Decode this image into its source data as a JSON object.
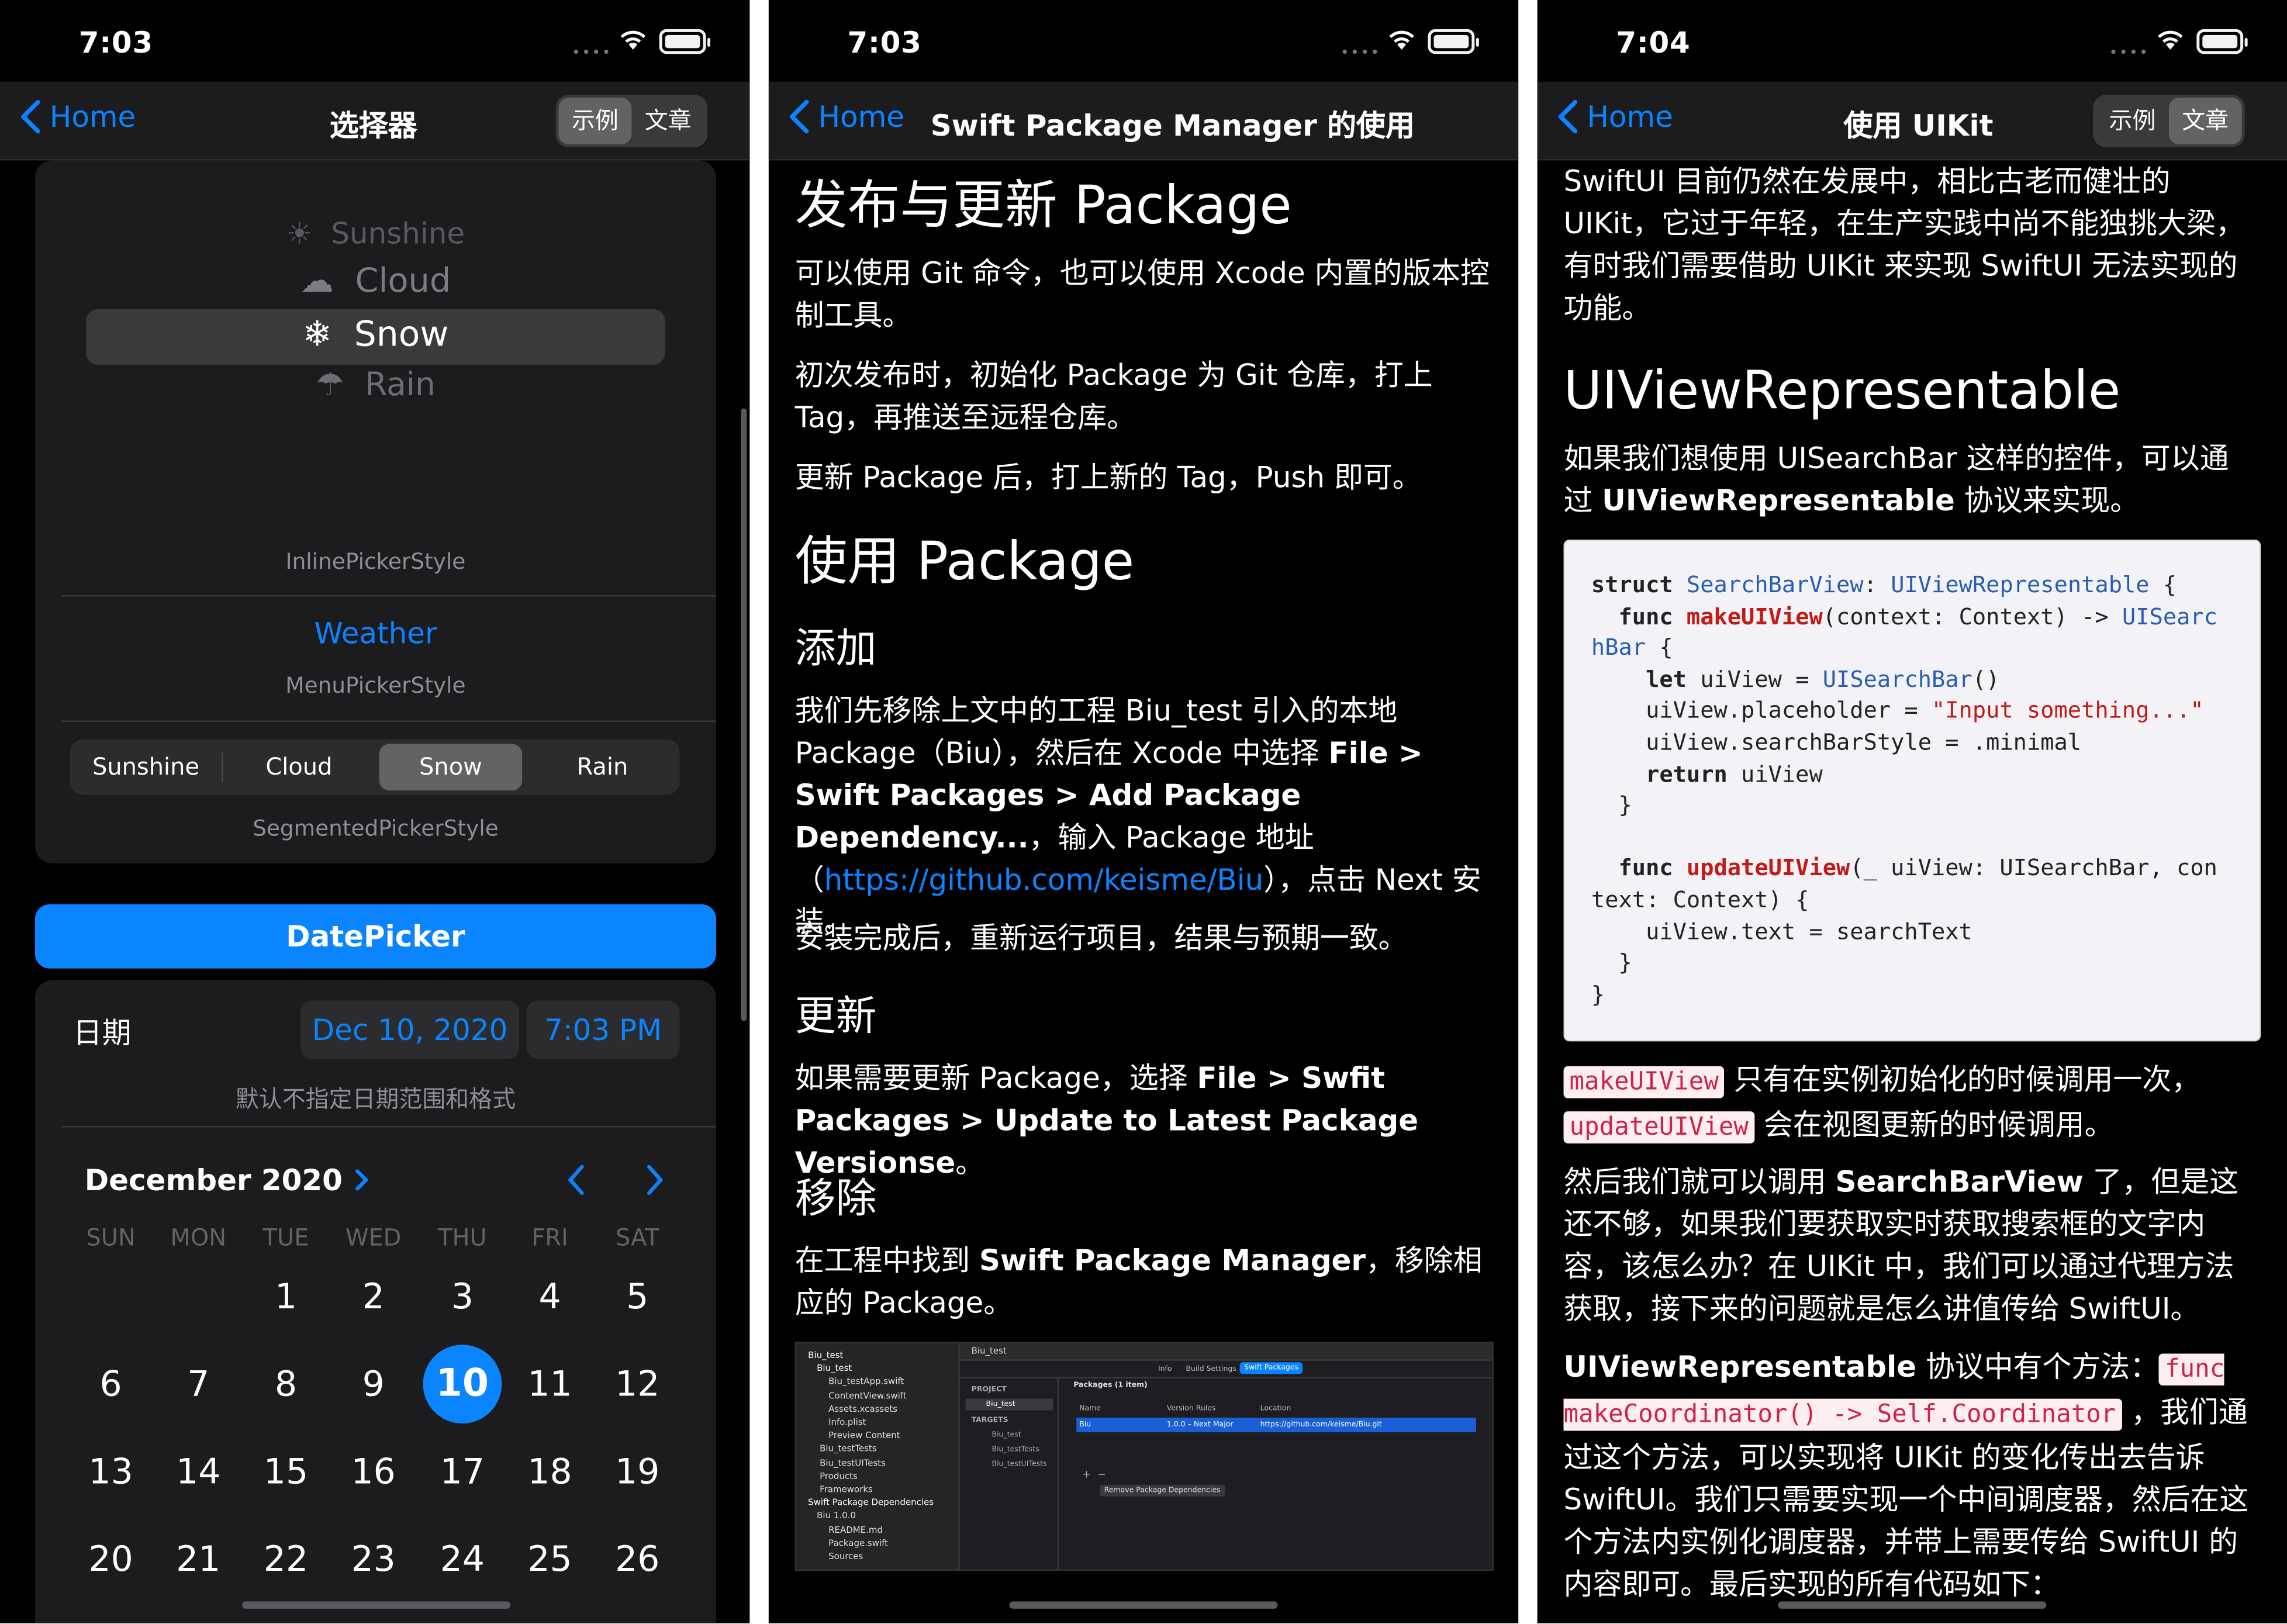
{
  "status": {
    "p1_time": "7:03",
    "p2_time": "7:03",
    "p3_time": "7:04"
  },
  "p1": {
    "back": "Home",
    "title": "选择器",
    "seg": [
      "示例",
      "文章"
    ],
    "wheel": [
      "Sunshine",
      "Cloud",
      "Snow",
      "Rain"
    ],
    "inline_label": "InlinePickerStyle",
    "menu_value": "Weather",
    "menu_label": "MenuPickerStyle",
    "segments": [
      "Sunshine",
      "Cloud",
      "Snow",
      "Rain"
    ],
    "segmented_label": "SegmentedPickerStyle",
    "datepicker_btn": "DatePicker",
    "date_label": "日期",
    "date_value": "Dec 10, 2020",
    "time_value": "7:03 PM",
    "date_hint": "默认不指定日期范围和格式",
    "month": "December 2020",
    "weekdays": [
      "SUN",
      "MON",
      "TUE",
      "WED",
      "THU",
      "FRI",
      "SAT"
    ],
    "days": [
      "1",
      "2",
      "3",
      "4",
      "5",
      "6",
      "7",
      "8",
      "9",
      "10",
      "11",
      "12",
      "13",
      "14",
      "15",
      "16",
      "17",
      "18",
      "19",
      "20",
      "21",
      "22",
      "23",
      "24",
      "25",
      "26"
    ],
    "selected_day": "10"
  },
  "p2": {
    "back": "Home",
    "title": "Swift Package Manager 的使用",
    "h_publish": "发布与更新 Package",
    "para1": "可以使用 Git 命令，也可以使用 Xcode 内置的版本控制工具。",
    "para2": "初次发布时，初始化 Package 为 Git 仓库，打上 Tag，再推送至远程仓库。",
    "para3": "更新 Package 后，打上新的 Tag，Push 即可。",
    "h_use": "使用 Package",
    "h_add": "添加",
    "add_a": "我们先移除上文中的工程 Biu_test 引入的本地 Package（Biu），然后在 Xcode 中选择 ",
    "add_b": "File > Swift Packages > Add Package Dependency...",
    "add_c": "，输入 Package 地址（",
    "add_link": "https://github.com/keisme/Biu",
    "add_d": "），点击 Next 安装。",
    "para_done": "安装完成后，重新运行项目，结果与预期一致。",
    "h_update": "更新",
    "upd_a": "如果需要更新 Package，选择 ",
    "upd_b": "File > Swfit Packages > Update to Latest Package Versionse",
    "upd_c": "。",
    "h_remove": "移除",
    "rm_a": "在工程中找到 ",
    "rm_b": "Swift Package Manager",
    "rm_c": "，移除相应的 Package。",
    "shot": {
      "project": "Biu_test",
      "group": "Biu_test",
      "files": [
        "Biu_testApp.swift",
        "ContentView.swift",
        "Assets.xcassets",
        "Info.plist",
        "Preview Content",
        "Biu_testTests",
        "Biu_testUITests",
        "Products",
        "Frameworks"
      ],
      "deps_header": "Swift Package Dependencies",
      "dep": "Biu 1.0.0",
      "dep_files": [
        "README.md",
        "Package.swift",
        "Sources"
      ],
      "tabs": [
        "Info",
        "Build Settings",
        "Swift Packages"
      ],
      "project_label": "PROJECT",
      "project_item": "Biu_test",
      "targets_label": "TARGETS",
      "targets": [
        "Biu_test",
        "Biu_testTests",
        "Biu_testUITests"
      ],
      "packages_title": "Packages (1 item)",
      "cols": [
        "Name",
        "Version Rules",
        "Location"
      ],
      "row": [
        "Biu",
        "1.0.0 – Next Major",
        "https://github.com/keisme/Biu.git"
      ],
      "remove_btn": "Remove Package Dependencies"
    }
  },
  "p3": {
    "back": "Home",
    "title": "使用 UIKit",
    "seg": [
      "示例",
      "文章"
    ],
    "intro": "SwiftUI 目前仍然在发展中，相比古老而健壮的 UIKit，它过于年轻，在生产实践中尚不能独挑大梁，有时我们需要借助 UIKit 来实现 SwiftUI 无法实现的功能。",
    "h_rep": "UIViewRepresentable",
    "rep_a": "如果我们想使用 UISearchBar 这样的控件，可以通过 ",
    "rep_b": "UIViewRepresentable",
    "rep_c": " 协议来实现。",
    "code": {
      "l1a": "struct ",
      "l1b": "SearchBarView",
      "l1c": ": ",
      "l1d": "UIViewRepresentable",
      "l1e": " {",
      "l2a": "  func ",
      "l2b": "makeUIView",
      "l2c": "(context: Context) -> ",
      "l2d": "UISearc",
      "l3a": "hBar",
      "l3b": " {",
      "l4a": "    let ",
      "l4b": "uiView = ",
      "l4c": "UISearchBar",
      "l4d": "()",
      "l5a": "    uiView.placeholder = ",
      "l5b": "\"Input something...\"",
      "l6": "    uiView.searchBarStyle = .minimal",
      "l7a": "    return ",
      "l7b": "uiView",
      "l8": "  }",
      "l9": "",
      "l10a": "  func ",
      "l10b": "updateUIView",
      "l10c": "(_ uiView: UISearchBar, con",
      "l11": "text: Context) {",
      "l12": "    uiView.text = searchText",
      "l13": "  }",
      "l14": "}"
    },
    "p_a1": "makeUIView",
    "p_a2": " 只有在实例初始化的时候调用一次，",
    "p_a3": "updateUIView",
    "p_a4": " 会在视图更新的时候调用。",
    "p_b1": "然后我们就可以调用 ",
    "p_b2": "SearchBarView",
    "p_b3": " 了，但是这还不够，如果我们要获取实时获取搜索框的文字内容，该怎么办？在 UIKit 中，我们可以通过代理方法获取，接下来的问题就是怎么讲值传给 SwiftUI。",
    "p_c1": "UIViewRepresentable",
    "p_c2": " 协议中有个方法：",
    "p_c3": "func makeCoordinator() -> Self.Coordinator",
    "p_c4": " ，我们通过这个方法，可以实现将 UIKit 的变化传出去告诉 SwiftUI。我们只需要实现一个中间调度器，然后在这个方法内实例化调度器，并带上需要传给 SwiftUI 的内容即可。最后实现的所有代码如下："
  }
}
